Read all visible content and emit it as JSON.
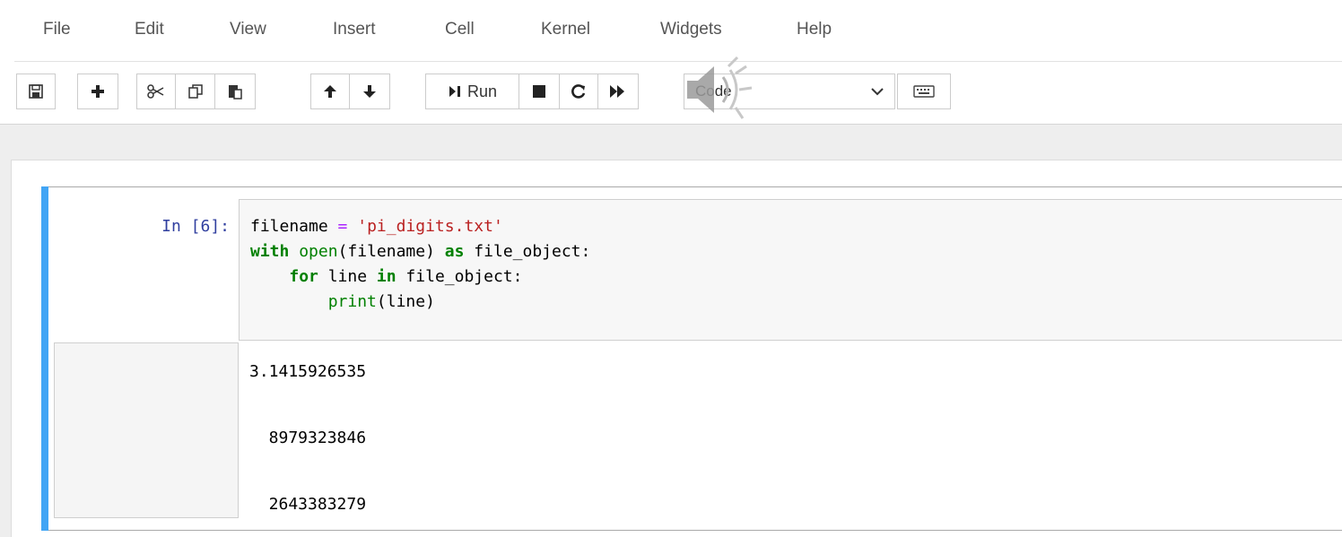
{
  "menubar": {
    "items": [
      "File",
      "Edit",
      "View",
      "Insert",
      "Cell",
      "Kernel",
      "Widgets",
      "Help"
    ]
  },
  "toolbar": {
    "run_label": "Run",
    "cell_type": "Code",
    "icons": [
      "save-icon",
      "plus-icon",
      "scissors-icon",
      "copy-icon",
      "paste-icon",
      "arrow-up-icon",
      "arrow-down-icon",
      "run-icon",
      "stop-icon",
      "restart-icon",
      "fast-forward-icon",
      "chevron-down-icon",
      "keyboard-icon",
      "speaker-icon"
    ]
  },
  "cell": {
    "prompt": "In [6]:",
    "code_lines": [
      "filename = 'pi_digits.txt'",
      "with open(filename) as file_object:",
      "    for line in file_object:",
      "        print(line)"
    ],
    "output_lines": [
      "3.1415926535",
      "",
      "  8979323846",
      "",
      "  2643383279"
    ]
  },
  "colors": {
    "accent": "#42a5f5",
    "prompt": "#303f9f",
    "keyword": "#008000",
    "string": "#ba2121",
    "operator": "#aa22ff"
  }
}
